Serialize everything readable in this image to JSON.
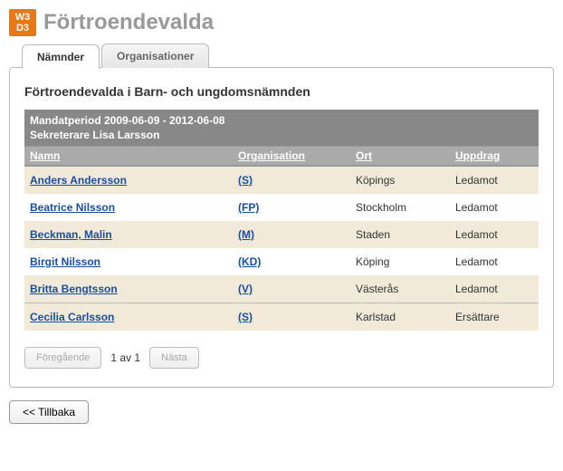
{
  "logo": {
    "line1": "W3",
    "line2": "D3"
  },
  "page_title": "Förtroendevalda",
  "tabs": [
    {
      "label": "Nämnder",
      "active": true
    },
    {
      "label": "Organisationer",
      "active": false
    }
  ],
  "panel": {
    "title": "Förtroendevalda i Barn- och ungdomsnämnden",
    "mandate_line1": "Mandatperiod 2009-06-09 - 2012-06-08",
    "mandate_line2": "Sekreterare Lisa Larsson",
    "columns": {
      "name": "Namn",
      "org": "Organisation",
      "ort": "Ort",
      "uppdrag": "Uppdrag"
    },
    "rows_main": [
      {
        "name": "Anders Andersson",
        "org": "(S)",
        "ort": "Köpings",
        "uppdrag": "Ledamot"
      },
      {
        "name": "Beatrice Nilsson",
        "org": "(FP)",
        "ort": "Stockholm",
        "uppdrag": "Ledamot"
      },
      {
        "name": "Beckman, Malin",
        "org": "(M)",
        "ort": "Staden",
        "uppdrag": "Ledamot"
      },
      {
        "name": "Birgit Nilsson",
        "org": "(KD)",
        "ort": "Köping",
        "uppdrag": "Ledamot"
      },
      {
        "name": "Britta Bengtsson",
        "org": "(V)",
        "ort": "Västerås",
        "uppdrag": "Ledamot"
      }
    ],
    "rows_sub": [
      {
        "name": "Cecilia Carlsson",
        "org": "(S)",
        "ort": "Karlstad",
        "uppdrag": "Ersättare"
      }
    ]
  },
  "pager": {
    "prev": "Föregående",
    "info": "1 av 1",
    "next": "Nästa"
  },
  "back_label": "<< Tillbaka"
}
